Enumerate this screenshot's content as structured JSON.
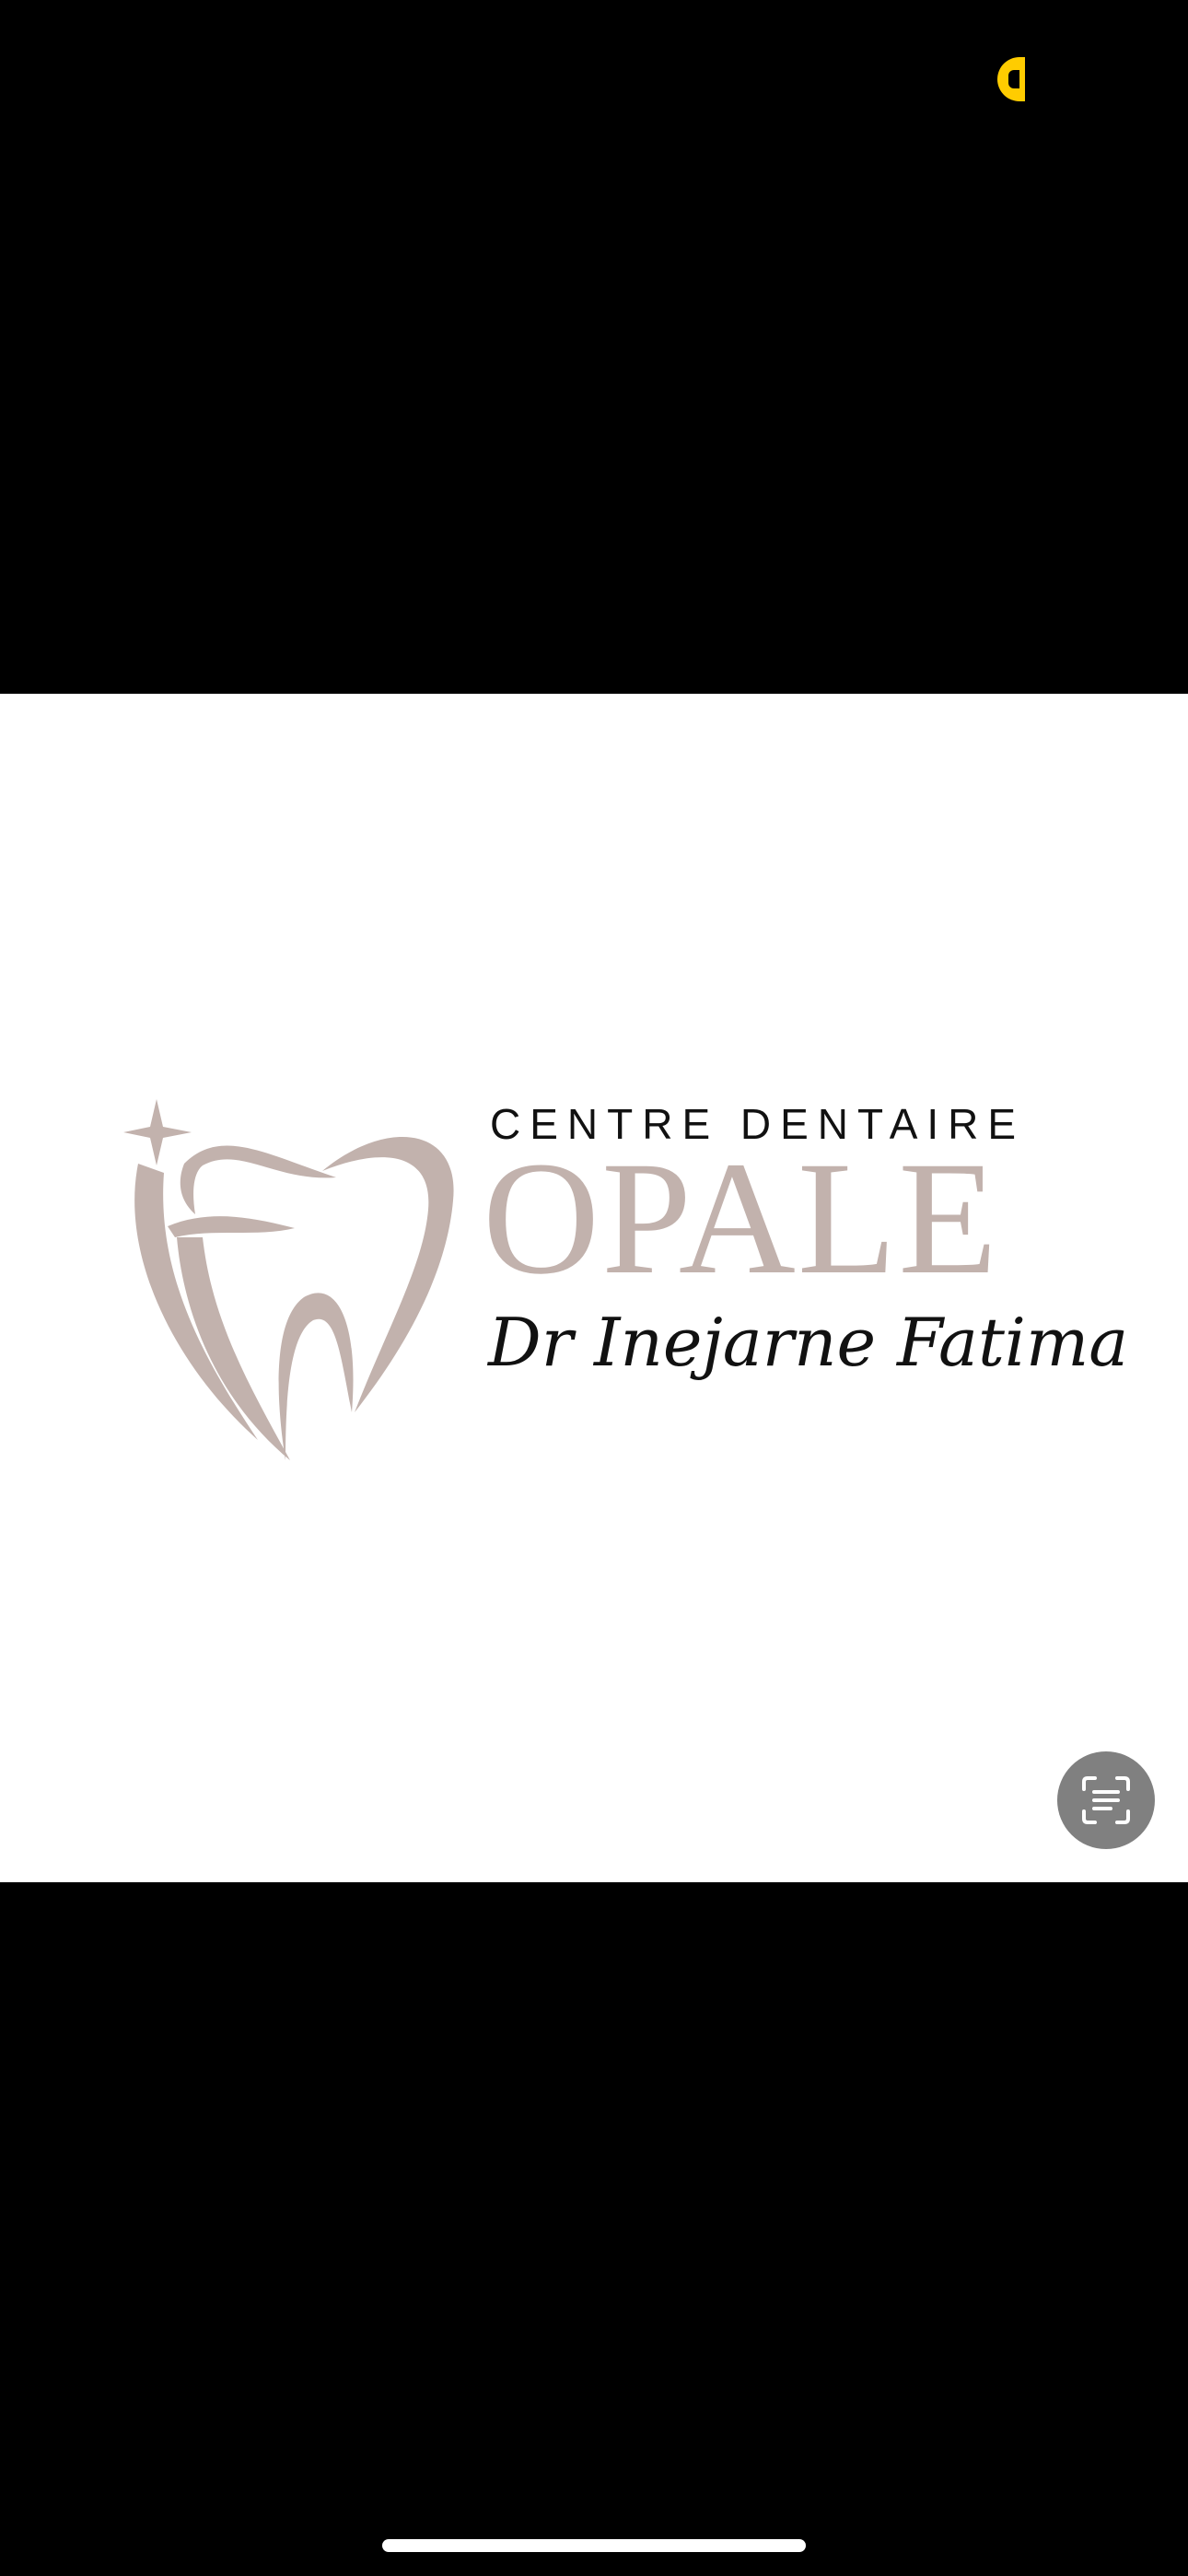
{
  "colors": {
    "background": "#000000",
    "photo_background": "#FFFFFF",
    "logo_accent": "#C2B2AD",
    "text_dark": "#111111",
    "status_indicator": "#FFCC00",
    "live_text_button": "#808080",
    "home_indicator": "#FFFFFF"
  },
  "status_bar": {
    "indicator_icon": "recording-indicator-icon"
  },
  "photo": {
    "logo": {
      "line1": "CENTRE DENTAIRE",
      "line2": "OPALE",
      "line3": "Dr Inejarne Fatima",
      "mark_icon": "tooth-sparkle-logo-icon"
    }
  },
  "controls": {
    "live_text_icon": "live-text-scan-icon"
  }
}
